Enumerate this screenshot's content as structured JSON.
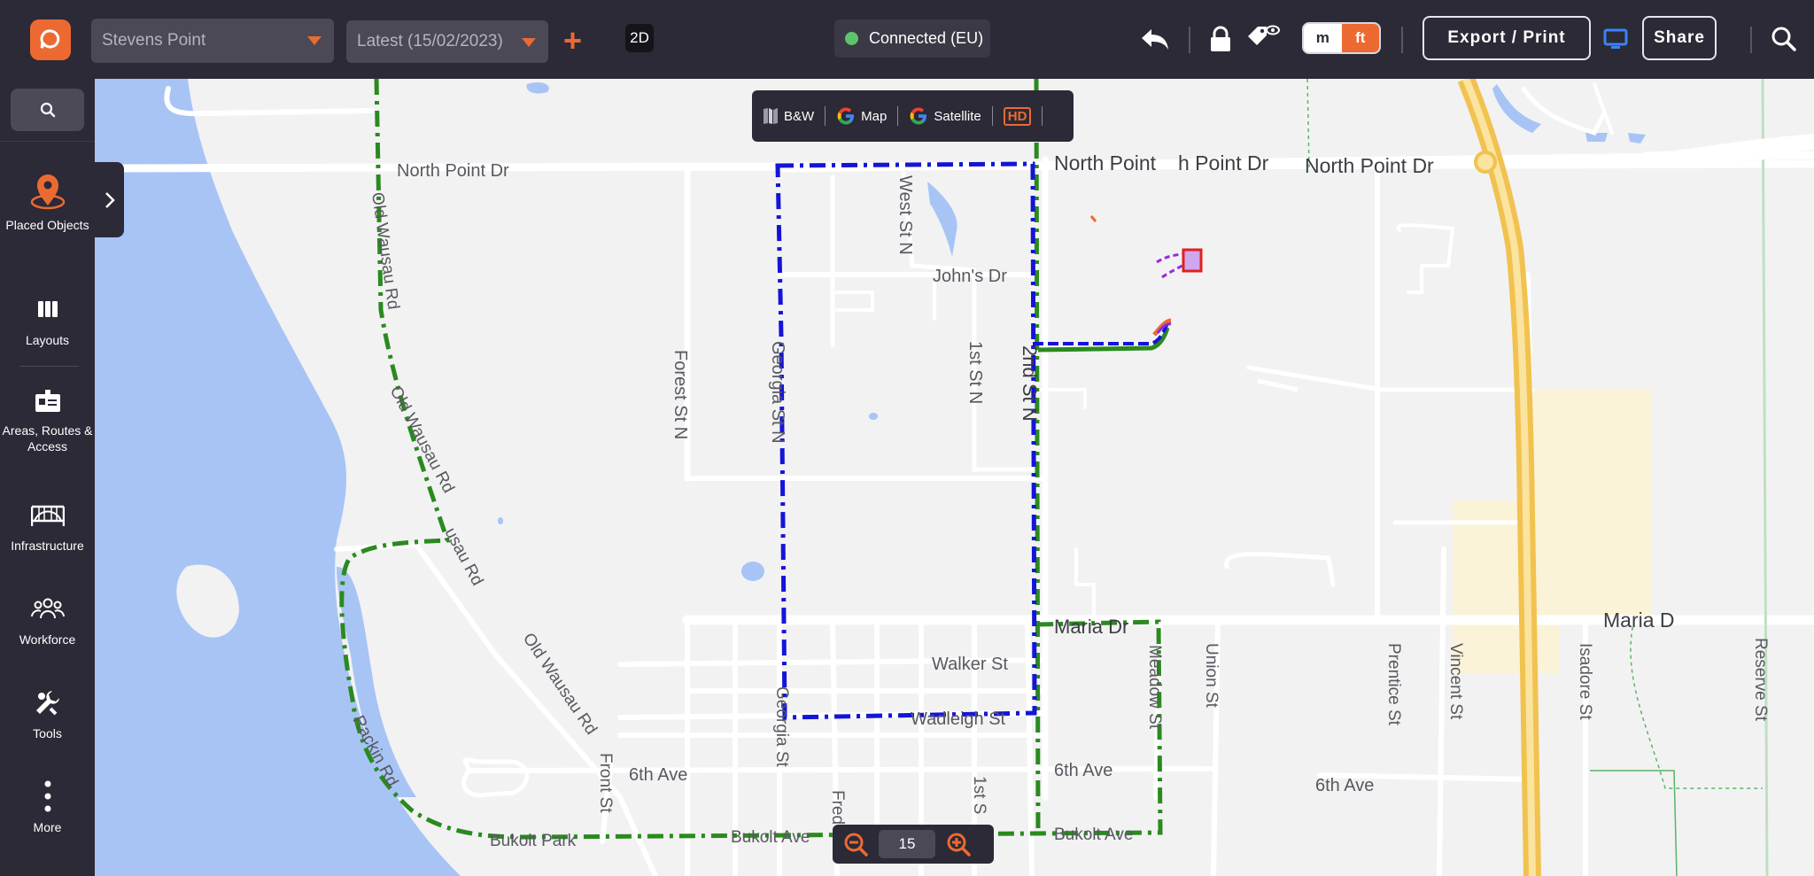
{
  "header": {
    "site_select": "Stevens Point",
    "version_select": "Latest (15/02/2023)",
    "add_label": "+",
    "view_mode": "2D",
    "connection_status": "Connected (EU)",
    "unit_m": "m",
    "unit_ft": "ft",
    "export_label": "Export / Print",
    "share_label": "Share"
  },
  "sidebar": {
    "items": [
      {
        "label": "Placed Objects",
        "icon": "map-pin-icon"
      },
      {
        "label": "Layouts",
        "icon": "columns-icon"
      },
      {
        "label": "Areas, Routes & Access",
        "icon": "id-card-icon"
      },
      {
        "label": "Infrastructure",
        "icon": "bridge-icon"
      },
      {
        "label": "Workforce",
        "icon": "people-icon"
      },
      {
        "label": "Tools",
        "icon": "wrench-icon"
      },
      {
        "label": "More",
        "icon": "kebab-icon"
      }
    ]
  },
  "map_type": {
    "bw": "B&W",
    "map": "Map",
    "satellite": "Satellite",
    "hd": "HD"
  },
  "zoom": {
    "level": "15"
  },
  "map_labels": {
    "north_point_dr_left": "North Point Dr",
    "north_point_a": "North Point",
    "north_point_b": "h Point Dr",
    "north_point_c": "North Point Dr",
    "west_st_n": "West St N",
    "johns_dr": "John's Dr",
    "old_wausau_rd_1": "Old Wausau Rd",
    "old_wausau_rd_2": "Old Wausau Rd",
    "old_wausau_rd_3": "Old Wausau Rd",
    "wausau_rd": "usau Rd",
    "forest_st_n": "Forest St N",
    "georgia_st_n": "Georgia St N",
    "first_st_n": "1st St N",
    "second_st_n": "2nd St N",
    "maria_dr_1": "Maria Dr",
    "maria_dr_2": "Maria D",
    "walker_st": "Walker St",
    "wadleigh_st": "Wadleigh St",
    "meadow_st": "Meadow St",
    "union_st": "Union St",
    "prentice_st": "Prentice St",
    "vincent_st": "Vincent St",
    "isadore_st": "Isadore St",
    "reserve_st": "Reserve St",
    "sixth_ave_1": "6th Ave",
    "sixth_ave_2": "6th Ave",
    "sixth_ave_3": "6th Ave",
    "front_st": "Front St",
    "georgia_st": "Georgia St",
    "fred_st": "Fred",
    "first_s": "1st S",
    "rackin_rd": "Rackin Rd",
    "bukolt_park": "Bukolt Park",
    "bukolt_ave_1": "Bukolt Ave",
    "bukolt_ave_2": "Bukolt Ave"
  }
}
